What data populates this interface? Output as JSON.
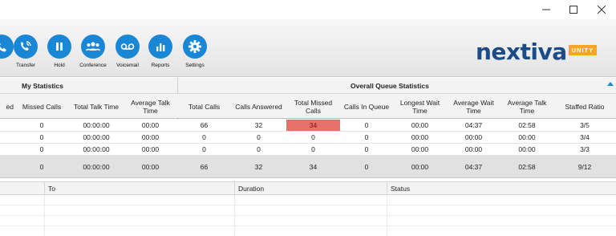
{
  "window": {
    "controls": [
      {
        "name": "minimize-button",
        "icon": "minimize-icon"
      },
      {
        "name": "maximize-button",
        "icon": "maximize-icon"
      },
      {
        "name": "close-button",
        "icon": "close-icon"
      }
    ]
  },
  "toolbar": {
    "buttons": [
      {
        "label": "",
        "icon": "call-icon"
      },
      {
        "label": "Transfer",
        "icon": "transfer-icon"
      },
      {
        "label": "Hold",
        "icon": "pause-icon"
      },
      {
        "label": "Conference",
        "icon": "conference-icon"
      },
      {
        "label": "Voicemail",
        "icon": "voicemail-icon"
      },
      {
        "label": "Reports",
        "icon": "reports-icon"
      },
      {
        "label": "Settings",
        "icon": "gear-icon"
      }
    ],
    "accent_color": "#1a86d6"
  },
  "logo": {
    "text": "nextiva",
    "badge": "UNITY",
    "brand_color": "#1b4c87",
    "badge_color": "#f5a623"
  },
  "stats": {
    "my_title": "My Statistics",
    "queue_title": "Overall Queue Statistics",
    "columns": [
      "ed",
      "Missed Calls",
      "Total Talk Time",
      "Average Talk Time",
      "Total Calls",
      "Calls Answered",
      "Total Missed Calls",
      "Calls In Queue",
      "Longest Wait Time",
      "Average Wait Time",
      "Average Talk Time",
      "Staffed Ratio"
    ],
    "rows": [
      [
        "",
        "0",
        "00:00:00",
        "00:00",
        "66",
        "32",
        "34",
        "0",
        "00:00",
        "04:37",
        "02:58",
        "3/5"
      ],
      [
        "",
        "0",
        "00:00:00",
        "00:00",
        "0",
        "0",
        "0",
        "0",
        "00:00",
        "00:00",
        "00:00",
        "3/4"
      ],
      [
        "",
        "0",
        "00:00:00",
        "00:00",
        "0",
        "0",
        "0",
        "0",
        "00:00",
        "00:00",
        "00:00",
        "3/3"
      ]
    ],
    "total": [
      "",
      "0",
      "00:00:00",
      "00:00",
      "66",
      "32",
      "34",
      "0",
      "00:00",
      "04:37",
      "02:58",
      "9/12"
    ],
    "alert_color": "#e8706a"
  },
  "call_list": {
    "columns": [
      "",
      "To",
      "Duration",
      "Status"
    ]
  }
}
